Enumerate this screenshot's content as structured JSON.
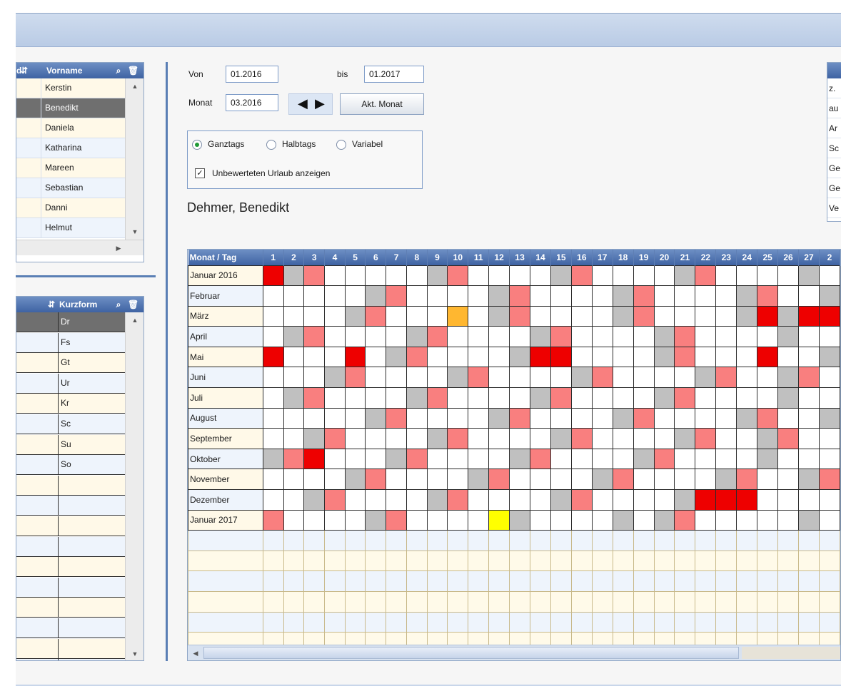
{
  "topList": {
    "header": {
      "col1_partial": "d",
      "col2": "Vorname"
    },
    "items": [
      "Kerstin",
      "Benedikt",
      "Daniela",
      "Katharina",
      "Mareen",
      "Sebastian",
      "Danni",
      "Helmut"
    ],
    "selected_index": 1
  },
  "bottomList": {
    "header": {
      "col2": "Kurzform"
    },
    "items": [
      "Dr",
      "Fs",
      "Gt",
      "Ur",
      "Kr",
      "Sc",
      "Su",
      "So"
    ],
    "selected_index": 0,
    "empty_rows": 10
  },
  "controls": {
    "von_label": "Von",
    "von_value": "01.2016",
    "bis_label": "bis",
    "bis_value": "01.2017",
    "monat_label": "Monat",
    "monat_value": "03.2016",
    "prev_arrow": "◀",
    "next_arrow": "▶",
    "akt_monat_label": "Akt. Monat",
    "radio_ganztags": "Ganztags",
    "radio_halbtags": "Halbtags",
    "radio_variabel": "Variabel",
    "selected_radio": "Ganztags",
    "checkbox_label": "Unbewerteten Urlaub anzeigen",
    "checkbox_checked": true
  },
  "employee_name": "Dehmer, Benedikt",
  "rightPanel": {
    "items": [
      "z.",
      "au",
      "Ar",
      "Sc",
      "Ge",
      "Ge",
      "Ve"
    ]
  },
  "calendar": {
    "header_label": "Monat / Tag",
    "days": [
      "1",
      "2",
      "3",
      "4",
      "5",
      "6",
      "7",
      "8",
      "9",
      "10",
      "11",
      "12",
      "13",
      "14",
      "15",
      "16",
      "17",
      "18",
      "19",
      "20",
      "21",
      "22",
      "23",
      "24",
      "25",
      "26",
      "27",
      "2"
    ],
    "legend_colors": {
      "weekend": "#c0c0c0",
      "holiday": "#f97f7f",
      "vacation": "#ee0000",
      "halfday": "#ffb730",
      "unrated": "#ffff00"
    },
    "rows": [
      {
        "month": "Januar 2016",
        "cells": "rgp.....gp....gp....gp....g."
      },
      {
        "month": "Februar",
        "cells": ".....gp....gp....gp....gp..g"
      },
      {
        "month": "März",
        "cells": "....gp...o.gp....gp....grgrr"
      },
      {
        "month": "April",
        "cells": ".gp....gp....gp....gp....g.."
      },
      {
        "month": "Mai",
        "cells": "r...r.gp....grr....gp...r..g"
      },
      {
        "month": "Juni",
        "cells": "...gp....gp....gp....gp..gp."
      },
      {
        "month": "Juli",
        "cells": ".gp....gp....gp....gp....g.."
      },
      {
        "month": "August",
        "cells": ".....gp....gp....gp....gp..g"
      },
      {
        "month": "September",
        "cells": "..gp....gp....gp....gp..gp.."
      },
      {
        "month": "Oktober",
        "cells": "gpr...gp....gp....gp....g..."
      },
      {
        "month": "November",
        "cells": "....gp....gp....gp....gp..gp"
      },
      {
        "month": "Dezember",
        "cells": "..gp....gp....gp....grrr...."
      },
      {
        "month": "Januar 2017",
        "cells": "p....gp....yg....g.gp.....g."
      }
    ],
    "empty_rows": 6
  }
}
